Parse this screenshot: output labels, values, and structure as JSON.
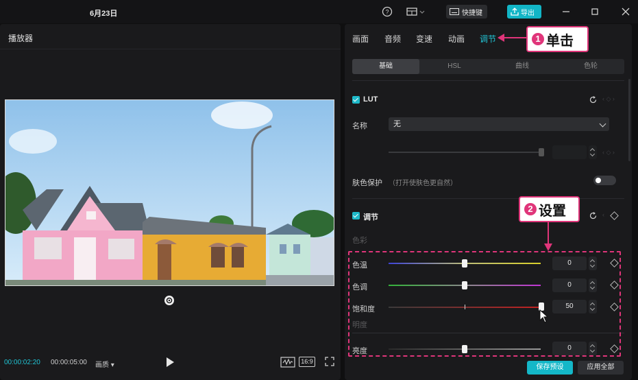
{
  "titlebar": {
    "date": "6月23日",
    "shortcut_label": "快捷键",
    "export_label": "导出"
  },
  "player": {
    "title": "播放器",
    "time_current": "00:00:02:20",
    "time_total": "00:00:05:00",
    "quality_label": "画质",
    "ratio_label": "16:9"
  },
  "panel": {
    "tabs": [
      {
        "label": "画面",
        "active": false
      },
      {
        "label": "音频",
        "active": false
      },
      {
        "label": "变速",
        "active": false
      },
      {
        "label": "动画",
        "active": false
      },
      {
        "label": "调节",
        "active": true
      }
    ],
    "subtabs": [
      {
        "label": "基础",
        "active": true
      },
      {
        "label": "HSL",
        "active": false
      },
      {
        "label": "曲线",
        "active": false
      },
      {
        "label": "色轮",
        "active": false
      }
    ],
    "lut": {
      "title": "LUT",
      "name_label": "名称",
      "name_value": "无"
    },
    "skin": {
      "label": "肤色保护",
      "hint": "（打开使肤色更自然）",
      "enabled": false
    },
    "adjust": {
      "title": "调节",
      "color_group": "色彩",
      "brightness_group": "明度",
      "sliders": [
        {
          "label": "色温",
          "value": "0",
          "fraction": 0.5
        },
        {
          "label": "色调",
          "value": "0",
          "fraction": 0.5
        },
        {
          "label": "饱和度",
          "value": "50",
          "fraction": 1.0
        },
        {
          "label": "亮度",
          "value": "0",
          "fraction": 0.5
        }
      ]
    },
    "save_preset_label": "保存预设",
    "apply_all_label": "应用全部"
  },
  "annotations": {
    "step1": {
      "num": "1",
      "text": "单击"
    },
    "step2": {
      "num": "2",
      "text": "设置"
    }
  },
  "colors": {
    "accent": "#12b5c6",
    "annotation": "#e0357a"
  }
}
